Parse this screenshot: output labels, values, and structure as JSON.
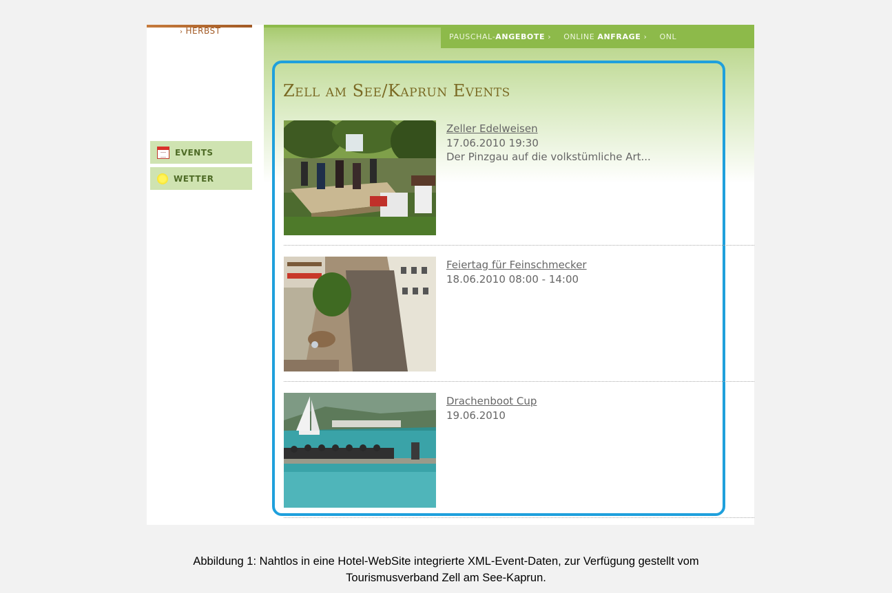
{
  "sidebar": {
    "herbst_label": "HERBST",
    "items": [
      {
        "label": "EVENTS",
        "icon": "calendar-icon"
      },
      {
        "label": "WETTER",
        "icon": "sun-icon"
      }
    ]
  },
  "nav": {
    "item1_prefix": "PAUSCHAL-",
    "item1_bold": "ANGEBOTE",
    "item2_prefix": "ONLINE ",
    "item2_bold": "ANFRAGE",
    "item3_prefix": "ONL",
    "arrow": "›"
  },
  "page_title": "Zell am See/Kaprun Events",
  "events": [
    {
      "title": "Zeller Edelweisen",
      "date": "17.06.2010 19:30",
      "description": "Der Pinzgau auf die volkstümliche Art..."
    },
    {
      "title": "Feiertag für Feinschmecker",
      "date": "18.06.2010 08:00 - 14:00",
      "description": ""
    },
    {
      "title": "Drachenboot Cup",
      "date": "19.06.2010",
      "description": ""
    }
  ],
  "caption_line1": "Abbildung 1: Nahtlos in eine Hotel-WebSite integrierte XML-Event-Daten, zur Verfügung gestellt vom",
  "caption_line2": "Tourismusverband Zell am See-Kaprun.",
  "colors": {
    "nav_green": "#8dba4a",
    "highlight_blue": "#1fa0dc",
    "title_brown": "#7a6a24"
  }
}
